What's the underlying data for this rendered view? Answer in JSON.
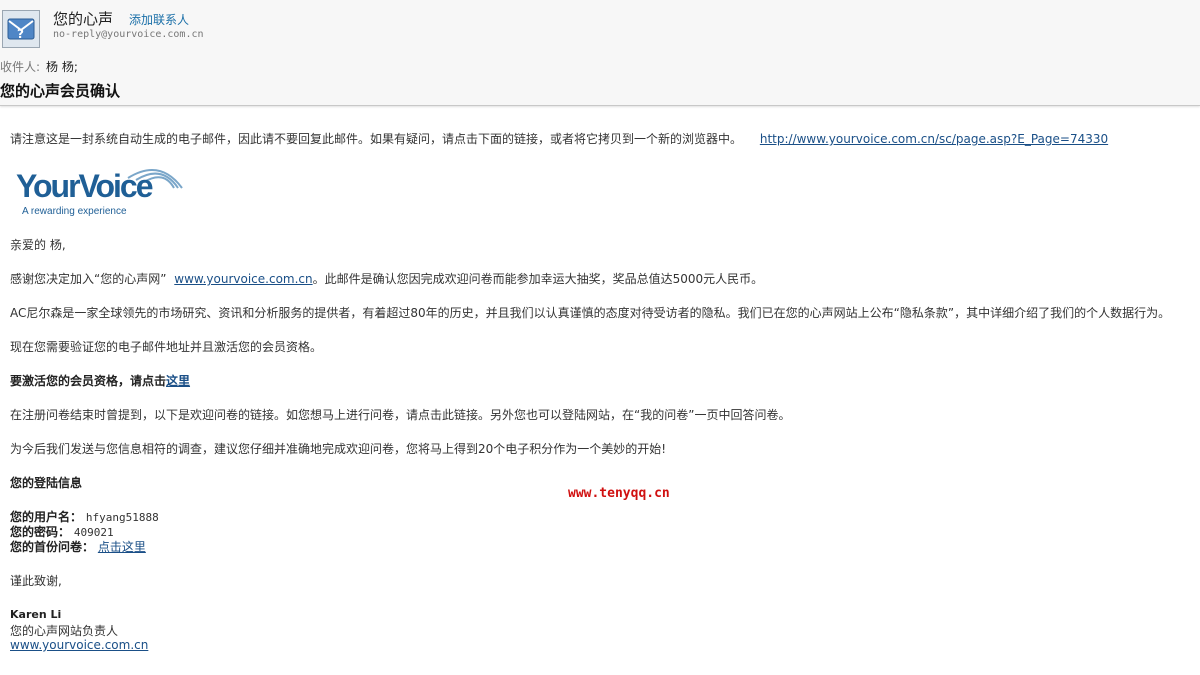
{
  "header": {
    "sender_name": "您的心声",
    "add_contact_label": "添加联系人",
    "sender_email": "no-reply@yourvoice.com.cn",
    "recipient_label": "收件人:",
    "recipient_name": "杨 杨;",
    "subject": "您的心声会员确认"
  },
  "body": {
    "notice_text": "请注意这是一封系统自动生成的电子邮件，因此请不要回复此邮件。如果有疑问，请点击下面的链接，或者将它拷贝到一个新的浏览器中。",
    "notice_link": "http://www.yourvoice.com.cn/sc/page.asp?E_Page=74330",
    "logo_wordmark": "YourVoice",
    "logo_tagline": "A rewarding experience",
    "greeting": "亲爱的 杨,",
    "thanks_pre": "感谢您决定加入“您的心声网”",
    "thanks_link": "www.yourvoice.com.cn",
    "thanks_post": "。此邮件是确认您因完成欢迎问卷而能参加幸运大抽奖，奖品总值达5000元人民币。",
    "acnielsen": "AC尼尔森是一家全球领先的市场研究、资讯和分析服务的提供者，有着超过80年的历史，并且我们以认真谨慎的态度对待受访者的隐私。我们已在您的心声网站上公布“隐私条款”，其中详细介绍了我们的个人数据行为。",
    "verify": "现在您需要验证您的电子邮件地址并且激活您的会员资格。",
    "activate_text": "要激活您的会员资格，请点击",
    "activate_link": "这里",
    "survey_info": "在注册问卷结束时曾提到，以下是欢迎问卷的链接。如您想马上进行问卷，请点击此链接。另外您也可以登陆网站，在“我的问卷”一页中回答问卷。",
    "points_info": "为今后我们发送与您信息相符的调查，建议您仔细并准确地完成欢迎问卷，您将马上得到20个电子积分作为一个美妙的开始!",
    "login_heading": "您的登陆信息",
    "username_label": "您的用户名：",
    "username_value": "hfyang51888",
    "password_label": "您的密码：",
    "password_value": "409021",
    "first_survey_label": "您的首份问卷：",
    "first_survey_link": "点击这里",
    "closing": "谨此致谢,",
    "signer_name": "Karen Li",
    "signer_title": "您的心声网站负责人",
    "signer_link": "www.yourvoice.com.cn"
  },
  "watermark": "www.tenyqq.cn",
  "colors": {
    "link": "#1a4f87",
    "logo_blue": "#1f5f96",
    "watermark_red": "#d01010"
  }
}
